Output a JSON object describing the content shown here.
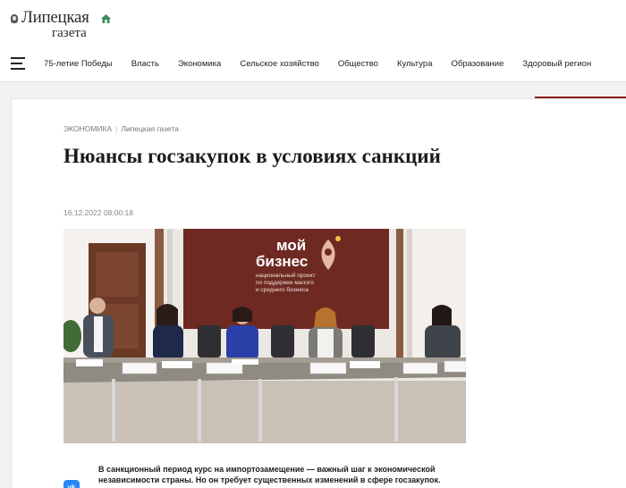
{
  "logo": {
    "line1": "Липецкая",
    "line2": "газета"
  },
  "nav": {
    "items": [
      "75-летие Победы",
      "Власть",
      "Экономика",
      "Сельское хозяйство",
      "Общество",
      "Культура",
      "Образование",
      "Здоровый регион"
    ]
  },
  "article": {
    "rubric": "Экономика",
    "source": "Липецкая газета",
    "title": "Нюансы госзакупок в условиях санкций",
    "date": "16.12.2022 08:00:18",
    "lead": "В санкционный период курс на импортозамещение — важный шаг к экономической независимости страны. Но он требует существенных изменений в сфере госзакупок."
  },
  "photo": {
    "banner_line1": "мой",
    "banner_line2": "бизнес",
    "banner_sub1": "национальный проект",
    "banner_sub2": "по поддержке малого",
    "banner_sub3": "и среднего бизнеса"
  },
  "share": {
    "vk_label": "vk"
  },
  "colors": {
    "accent_red": "#8b1a1a",
    "banner_bg": "#6e2a22",
    "vk_blue": "#2787f5"
  }
}
